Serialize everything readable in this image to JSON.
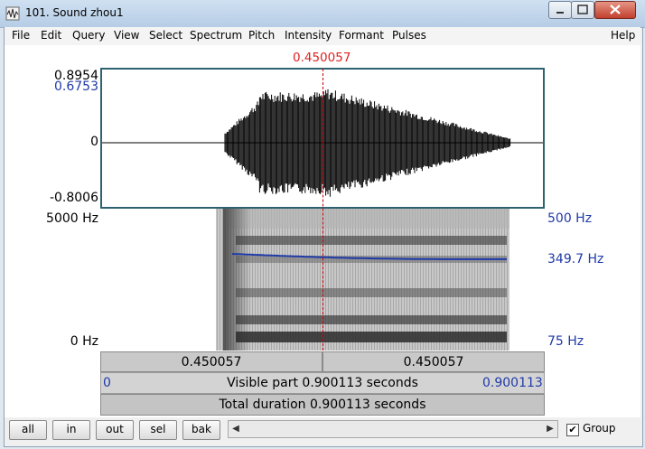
{
  "window": {
    "title": "101. Sound zhou1"
  },
  "menu": [
    "File",
    "Edit",
    "Query",
    "View",
    "Select",
    "Spectrum",
    "Pitch",
    "Intensity",
    "Formant",
    "Pulses",
    "Help"
  ],
  "cursor_time": "0.450057",
  "waveform": {
    "y_max": "0.8954",
    "y_cursor_value": "0.6753",
    "y_zero": "0",
    "y_min": "-0.8006"
  },
  "spectrogram": {
    "freq_top": "5000 Hz",
    "freq_bottom": "0 Hz",
    "pitch_top": "500 Hz",
    "pitch_value": "349.7 Hz",
    "pitch_bottom": "75 Hz"
  },
  "time_bar": {
    "left": "0.450057",
    "right": "0.450057"
  },
  "visible_bar": {
    "start": "0",
    "label": "Visible part 0.900113 seconds",
    "end": "0.900113"
  },
  "total_bar": {
    "label": "Total duration 0.900113 seconds"
  },
  "buttons": {
    "all": "all",
    "in": "in",
    "out": "out",
    "sel": "sel",
    "bak": "bak"
  },
  "group": {
    "label": "Group",
    "checked": true
  },
  "icons": [
    "app-icon",
    "minimize-icon",
    "maximize-icon",
    "close-icon",
    "scroll-left-icon",
    "scroll-right-icon",
    "check-icon"
  ],
  "colors": {
    "cursor": "#cc2222",
    "pitch": "#1f3aa8",
    "waveform_border": "#2f6270"
  }
}
